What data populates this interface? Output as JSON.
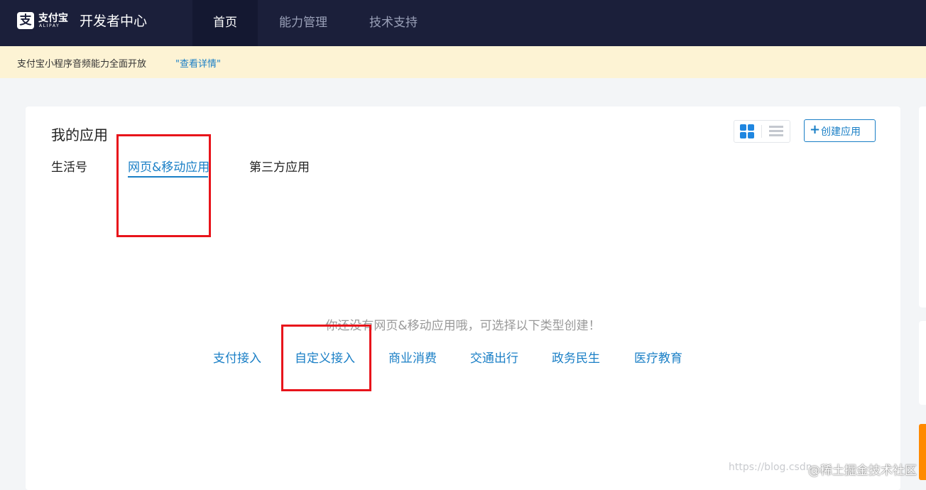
{
  "header": {
    "logo": {
      "mark": "支",
      "brand_cn": "支付宝",
      "brand_en": "ALIPAY"
    },
    "portal_title": "开发者中心",
    "nav": [
      {
        "label": "首页",
        "active": true
      },
      {
        "label": "能力管理",
        "active": false
      },
      {
        "label": "技术支持",
        "active": false
      }
    ],
    "bg_color": "#1b1f3a"
  },
  "notice": {
    "text": "支付宝小程序音频能力全面开放",
    "link": "\"查看详情\"",
    "bg_color": "#fdf3d4"
  },
  "apps_card": {
    "title": "我的应用",
    "view_modes": [
      {
        "icon": "grid-view-icon",
        "active": true
      },
      {
        "icon": "list-view-icon",
        "active": false
      }
    ],
    "create_button": {
      "icon": "plus-icon",
      "label": "创建应用"
    },
    "tabs": [
      {
        "label": "生活号",
        "active": false
      },
      {
        "label": "网页&移动应用",
        "active": true
      },
      {
        "label": "第三方应用",
        "active": false
      }
    ],
    "empty_message": "你还没有网页&移动应用哦，可选择以下类型创建！",
    "categories": [
      "支付接入",
      "自定义接入",
      "商业消费",
      "交通出行",
      "政务民生",
      "医疗教育"
    ]
  },
  "watermark": {
    "url": "https://blog.csdn",
    "text": "@稀土掘金技术社区"
  },
  "accent_color": "#1a7fc6",
  "highlight_color": "#e8141b"
}
